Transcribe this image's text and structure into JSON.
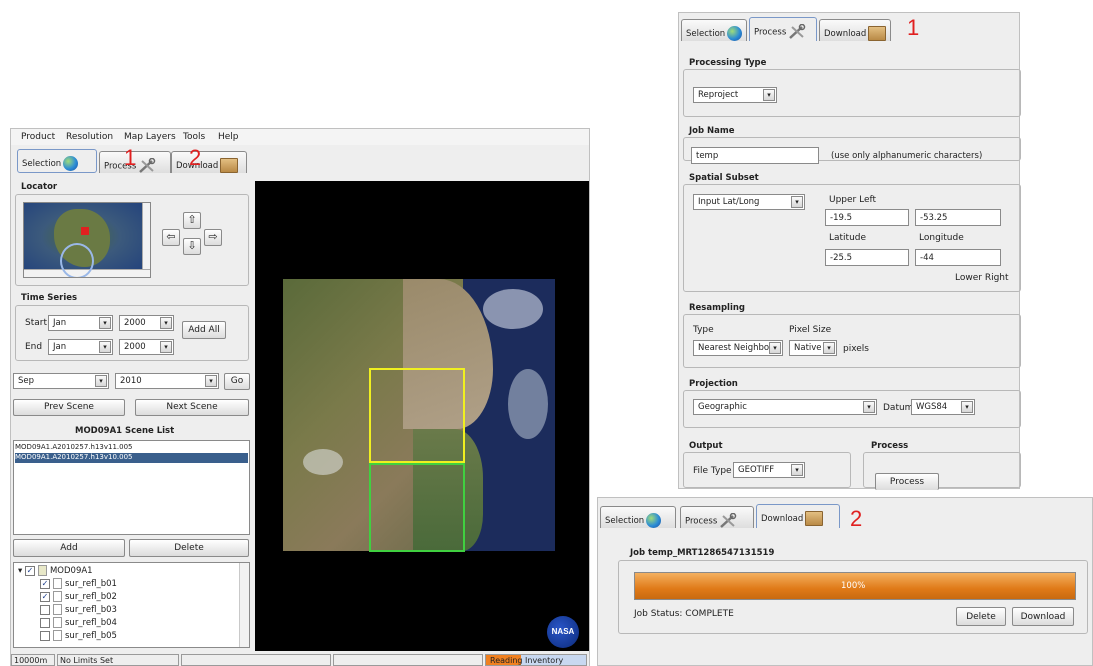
{
  "main": {
    "menu": [
      "Product",
      "Resolution",
      "Map Layers",
      "Tools",
      "Help"
    ],
    "tabs": {
      "selection": "Selection",
      "process": "Process",
      "download": "Download"
    },
    "callouts": {
      "one": "1",
      "two": "2"
    },
    "locator": {
      "title": "Locator",
      "arrows": {
        "left": "⇦",
        "up": "⇧",
        "down": "⇩",
        "right": "⇨"
      }
    },
    "time_series": {
      "title": "Time Series",
      "start_label": "Start",
      "start_month": "Jan",
      "start_year": "2000",
      "end_label": "End",
      "end_month": "Jan",
      "end_year": "2000",
      "add_all": "Add All"
    },
    "scene_nav": {
      "month": "Sep",
      "year": "2010",
      "go": "Go",
      "prev": "Prev Scene",
      "next": "Next Scene"
    },
    "scene_list": {
      "title": "MOD09A1 Scene List",
      "items": [
        "MOD09A1.A2010257.h13v11.005",
        "MOD09A1.A2010257.h13v10.005"
      ]
    },
    "add": "Add",
    "delete": "Delete",
    "tree": {
      "root": "MOD09A1",
      "bands": [
        {
          "label": "sur_refl_b01",
          "checked": true
        },
        {
          "label": "sur_refl_b02",
          "checked": true
        },
        {
          "label": "sur_refl_b03",
          "checked": false
        },
        {
          "label": "sur_refl_b04",
          "checked": false
        },
        {
          "label": "sur_refl_b05",
          "checked": false
        }
      ]
    },
    "status": {
      "scale": "10000m",
      "limits": "No Limits Set",
      "inventory": "Reading Inventory"
    },
    "nasa_logo": "NASA",
    "colors": {
      "overlay_yellow": "#f0f020",
      "overlay_green": "#40d040",
      "status_orange": "#f08020"
    }
  },
  "process_panel": {
    "tabs": {
      "selection": "Selection",
      "process": "Process",
      "download": "Download"
    },
    "callout": "1",
    "processing_type": {
      "title": "Processing Type",
      "value": "Reproject"
    },
    "job_name": {
      "title": "Job Name",
      "value": "temp",
      "hint": "(use only alphanumeric characters)"
    },
    "spatial_subset": {
      "title": "Spatial Subset",
      "mode": "Input Lat/Long",
      "upper_left": "Upper Left",
      "ul_lat": "-19.5",
      "ul_lon": "-53.25",
      "latitude": "Latitude",
      "longitude": "Longitude",
      "lr_lat": "-25.5",
      "lr_lon": "-44",
      "lower_right": "Lower Right"
    },
    "resampling": {
      "title": "Resampling",
      "type_label": "Type",
      "type_value": "Nearest Neighbor",
      "pixel_size_label": "Pixel Size",
      "pixel_size_value": "Native",
      "pixels": "pixels"
    },
    "projection": {
      "title": "Projection",
      "value": "Geographic",
      "datum_label": "Datum",
      "datum_value": "WGS84"
    },
    "output": {
      "title": "Output",
      "file_type_label": "File Type",
      "file_type_value": "GEOTIFF"
    },
    "process": {
      "title": "Process",
      "button": "Process"
    }
  },
  "download_panel": {
    "tabs": {
      "selection": "Selection",
      "process": "Process",
      "download": "Download"
    },
    "callout": "2",
    "job_title": "Job temp_MRT1286547131519",
    "progress": 1.0,
    "progress_label": "100%",
    "status": "Job Status: COMPLETE",
    "delete": "Delete",
    "download": "Download"
  }
}
